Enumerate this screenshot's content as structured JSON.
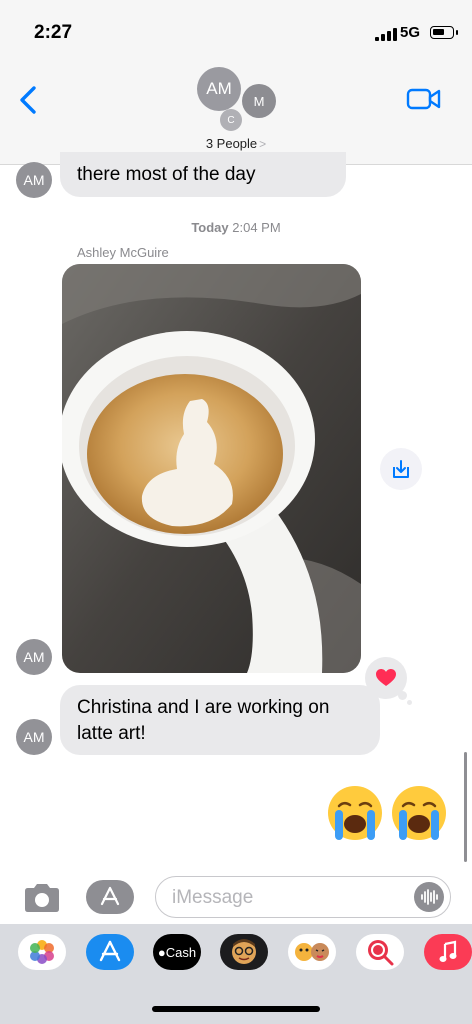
{
  "status_bar": {
    "time": "2:27",
    "network": "5G"
  },
  "header": {
    "avatars": {
      "main": "AM",
      "second": "M",
      "third": "C"
    },
    "people_label": "3 People",
    "people_chevron": ">"
  },
  "conversation": {
    "previous_message": "there most of the day",
    "timestamp_day": "Today",
    "timestamp_time": "2:04 PM",
    "sender_name": "Ashley  McGuire",
    "sender_initials": "AM",
    "photo_description_icon": "latte-art-photo",
    "tapback": "heart",
    "message": "Christina and I are working on latte art!",
    "outgoing_emojis": [
      "loudly-crying-face",
      "loudly-crying-face"
    ]
  },
  "input_bar": {
    "placeholder": "iMessage"
  },
  "app_drawer": {
    "apps": [
      "Photos",
      "App Store",
      "Cash",
      "Memoji",
      "Animoji",
      "Search",
      "Music"
    ],
    "cash_label": "Cash"
  },
  "colors": {
    "accent": "#007aff",
    "bubble_gray": "#e9e9eb",
    "avatar_gray": "#929297",
    "heart": "#ff2d55"
  }
}
